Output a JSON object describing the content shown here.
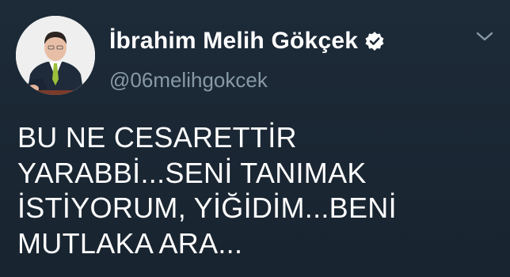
{
  "user": {
    "display_name": "İbrahim Melih Gökçek",
    "handle": "@06melihgokcek",
    "verified": true,
    "avatar_icon": "profile-photo"
  },
  "tweet": {
    "lines": [
      "BU NE CESARETTİR",
      "YARABBİ...SENİ TANIMAK",
      "İSTİYORUM, YİĞİDİM...BENİ",
      "MUTLAKA ARA..."
    ]
  },
  "menu_icon": "chevron-down-icon",
  "colors": {
    "background": "#1b2836",
    "text": "#ffffff",
    "secondary_text": "#8899a6",
    "verified_badge": "#ffffff"
  }
}
